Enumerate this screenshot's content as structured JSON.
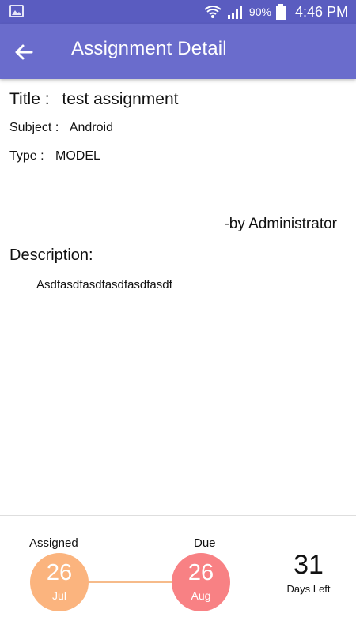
{
  "status_bar": {
    "battery_percent": "90%",
    "time": "4:46 PM",
    "icons": [
      "gallery-icon",
      "wifi-icon",
      "signal-icon",
      "battery-icon"
    ]
  },
  "app_bar": {
    "title": "Assignment Detail",
    "back_icon": "arrow-left-icon",
    "color": "#6a6ccc"
  },
  "assignment": {
    "title_label": "Title :",
    "title_value": "test assignment",
    "subject_label": "Subject :",
    "subject_value": "Android",
    "type_label": "Type :",
    "type_value": "MODEL",
    "by": "-by Administrator",
    "description_label": "Description:",
    "description_text": "Asdfasdfasdfasdfasdfasdf"
  },
  "timeline": {
    "assigned_label": "Assigned",
    "assigned_day": "26",
    "assigned_month": "Jul",
    "due_label": "Due",
    "due_day": "26",
    "due_month": "Aug",
    "days_left_value": "31",
    "days_left_caption": "Days Left",
    "colors": {
      "assigned": "#fbb47e",
      "due": "#f88184",
      "connector": "#f6bb8a"
    }
  }
}
